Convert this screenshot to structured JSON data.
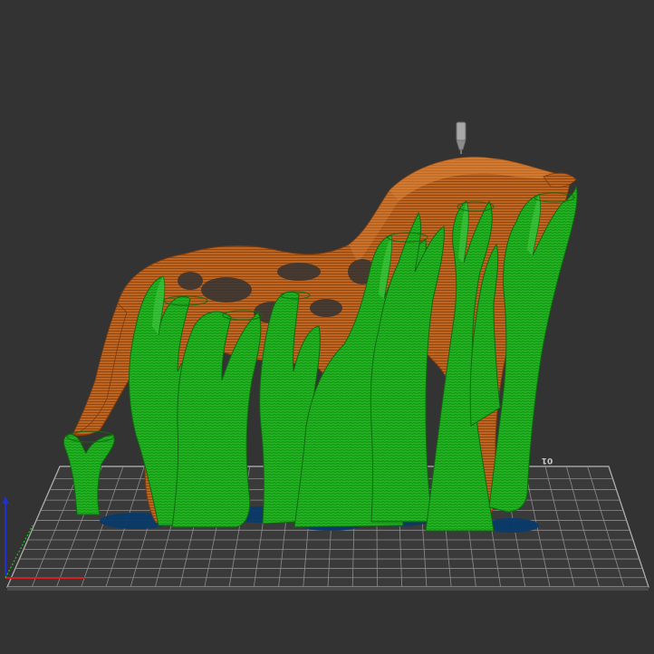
{
  "viewport": {
    "background": "#333333",
    "bed_label": "01"
  },
  "colors": {
    "bed_fill": "#3a3a3a",
    "bed_grid": "#8c8c8c",
    "bed_edge": "#c8c8c8",
    "model_fill": "#c0651f",
    "model_shade": "#7a3a0e",
    "model_highlight": "#e08a3c",
    "support_fill": "#22b722",
    "support_dark": "#0f6a0f",
    "support_light": "#5fe05f",
    "support_interface": "#0a3a6a",
    "axis_x": "#d42020",
    "axis_y": "#20c020",
    "axis_z": "#2030d0",
    "nozzle": "#a8a8a8"
  },
  "icons": {
    "nozzle": "nozzle-icon",
    "axes": "axis-gizmo-icon"
  }
}
